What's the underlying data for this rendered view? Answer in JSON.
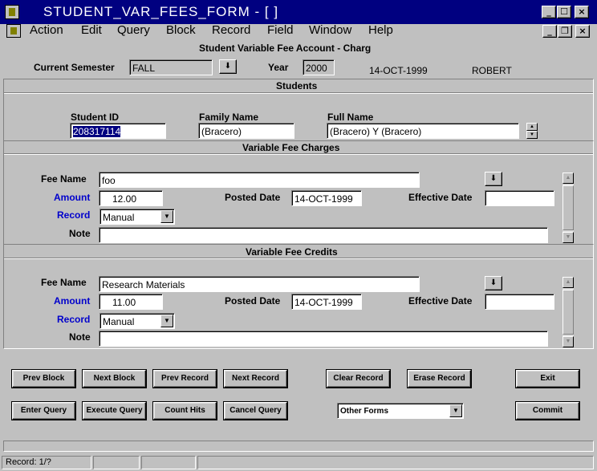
{
  "window": {
    "title": "STUDENT_VAR_FEES_FORM - [ ]",
    "minimize_glyph": "_",
    "maximize_glyph": "☐",
    "close_glyph": "×",
    "restore_glyph": "❐"
  },
  "menu": {
    "items": [
      "Action",
      "Edit",
      "Query",
      "Block",
      "Record",
      "Field",
      "Window",
      "Help"
    ]
  },
  "header": {
    "form_title": "Student Variable Fee Account - Charg",
    "semester_label": "Current Semester",
    "semester_value": "FALL",
    "year_label": "Year",
    "year_value": "2000",
    "date": "14-OCT-1999",
    "user": "ROBERT",
    "list_glyph": "⬇"
  },
  "students": {
    "section_title": "Students",
    "id_label": "Student ID",
    "id_value": "208317114",
    "family_label": "Family Name",
    "family_value": "(Bracero)",
    "full_label": "Full Name",
    "full_value": "(Bracero) Y (Bracero)"
  },
  "charges": {
    "section_title": "Variable Fee Charges",
    "fee_name_label": "Fee Name",
    "fee_name_value": "foo",
    "amount_label": "Amount",
    "amount_value": "12.00",
    "posted_label": "Posted Date",
    "posted_value": "14-OCT-1999",
    "effective_label": "Effective Date",
    "effective_value": "",
    "record_label": "Record",
    "record_value": "Manual",
    "note_label": "Note",
    "note_value": ""
  },
  "credits": {
    "section_title": "Variable Fee Credits",
    "fee_name_label": "Fee Name",
    "fee_name_value": "Research Materials",
    "amount_label": "Amount",
    "amount_value": "11.00",
    "posted_label": "Posted Date",
    "posted_value": "14-OCT-1999",
    "effective_label": "Effective Date",
    "effective_value": "",
    "record_label": "Record",
    "record_value": "Manual",
    "note_label": "Note",
    "note_value": ""
  },
  "buttons": {
    "prev_block": "Prev Block",
    "next_block": "Next Block",
    "prev_record": "Prev Record",
    "next_record": "Next Record",
    "clear_record": "Clear Record",
    "erase_record": "Erase Record",
    "exit": "Exit",
    "enter_query": "Enter Query",
    "execute_query": "Execute Query",
    "count_hits": "Count Hits",
    "cancel_query": "Cancel Query",
    "other_forms": "Other Forms",
    "commit": "Commit"
  },
  "status": {
    "record": "Record: 1/?"
  },
  "colors": {
    "titlebar": "#000080",
    "label_blue": "#0000cc",
    "face": "#c0c0c0"
  }
}
